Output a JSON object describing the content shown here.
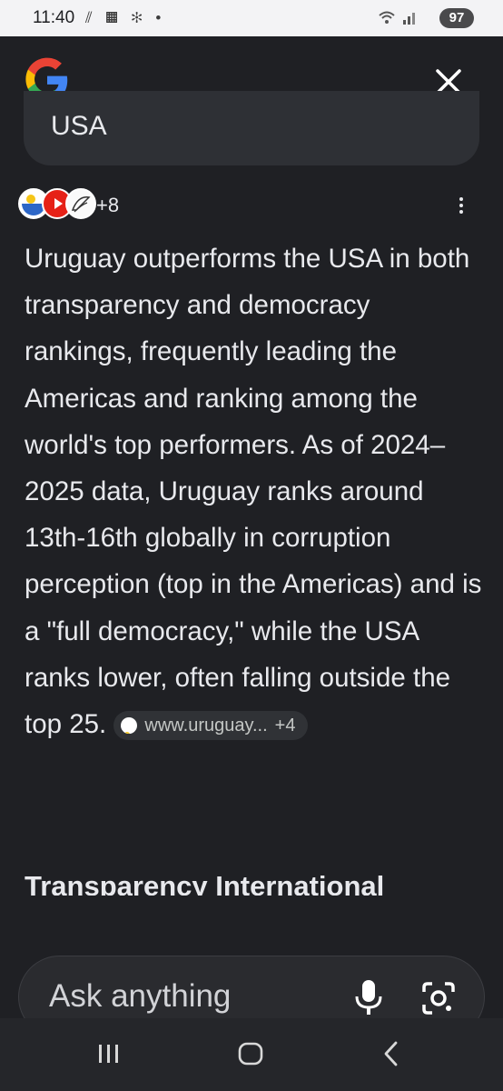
{
  "status_bar": {
    "time": "11:40",
    "left_icons": "⫽ ▦ ✻ •",
    "right_icons": "📶 .ıl",
    "battery": "97"
  },
  "header": {
    "logo": "google-g-icon",
    "close": "close-icon"
  },
  "query": {
    "text": "USA"
  },
  "sources": {
    "more_count": "+8",
    "icons": [
      "uruguay-flag-icon",
      "youtube-icon",
      "leaf-logo-icon"
    ]
  },
  "answer": {
    "text": "Uruguay outperforms the USA in both transparency and democracy rankings, frequently leading the Americas and ranking among the world's top performers. As of 2024–2025 data, Uruguay ranks around 13th-16th globally in corruption perception (top in the Americas) and is a \"full democracy,\" while the USA ranks lower, often falling outside the top 25.",
    "chip_label": "www.uruguay...",
    "chip_count": "+4"
  },
  "next_section": {
    "heading": "Transparency International"
  },
  "ask_bar": {
    "placeholder": "Ask anything"
  },
  "colors": {
    "background": "#1f2024",
    "text": "#e8e9ed",
    "chip_bg": "#303236",
    "ask_bg": "#2a2b2f"
  }
}
